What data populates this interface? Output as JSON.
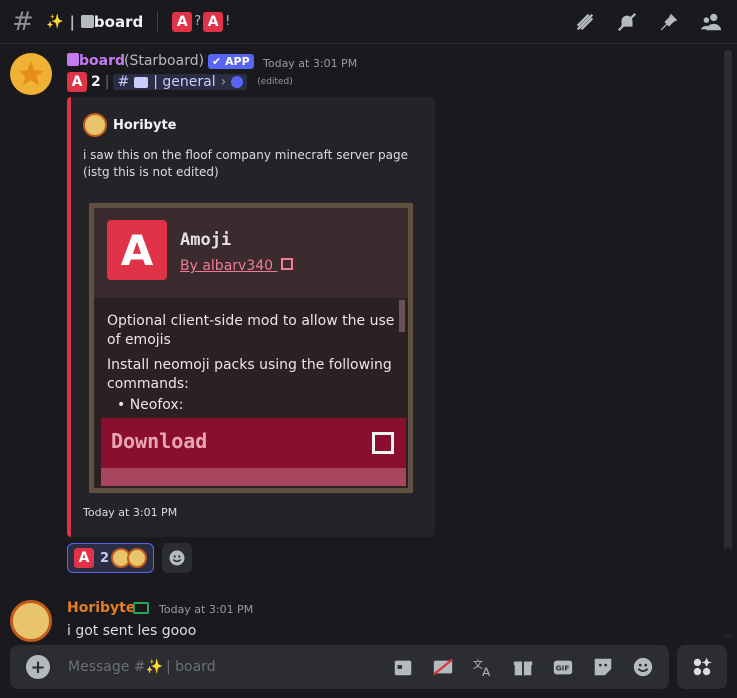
{
  "header": {
    "channel_prefix": "✨",
    "channel_name": "board",
    "topic_mid": "?",
    "topic_end": "!",
    "emoji_letter": "A"
  },
  "message1": {
    "username": "board",
    "username_suffix": "(Starboard)",
    "app_badge": "APP",
    "timestamp": "Today at 3:01 PM",
    "star_count": "2",
    "channel_link": "| general",
    "edited": "(edited)",
    "embed": {
      "author": "Horibyte",
      "description_line1": "i saw this on the floof company minecraft server page",
      "description_line2": "(istg this is not edited)",
      "footer": "Today at 3:01 PM",
      "image": {
        "mod_title": "Amoji",
        "mod_by": "By albarv340",
        "body_p1": "Optional client-side mod to allow the use of emojis",
        "body_p2": "Install neomoji packs using the following commands:",
        "body_cut": "• Neofox:",
        "download": "Download"
      }
    },
    "reactions": [
      {
        "count": "2"
      }
    ]
  },
  "message2": {
    "username": "Horibyte",
    "timestamp": "Today at 3:01 PM",
    "text": "i got sent les gooo"
  },
  "composer": {
    "placeholder_prefix": "Message #✨",
    "placeholder_channel": "| board"
  },
  "colors": {
    "accent": "#5865f2",
    "embed_border": "#e03347",
    "horibyte_name": "#e67e22",
    "starboard_name": "#c27cf0"
  }
}
